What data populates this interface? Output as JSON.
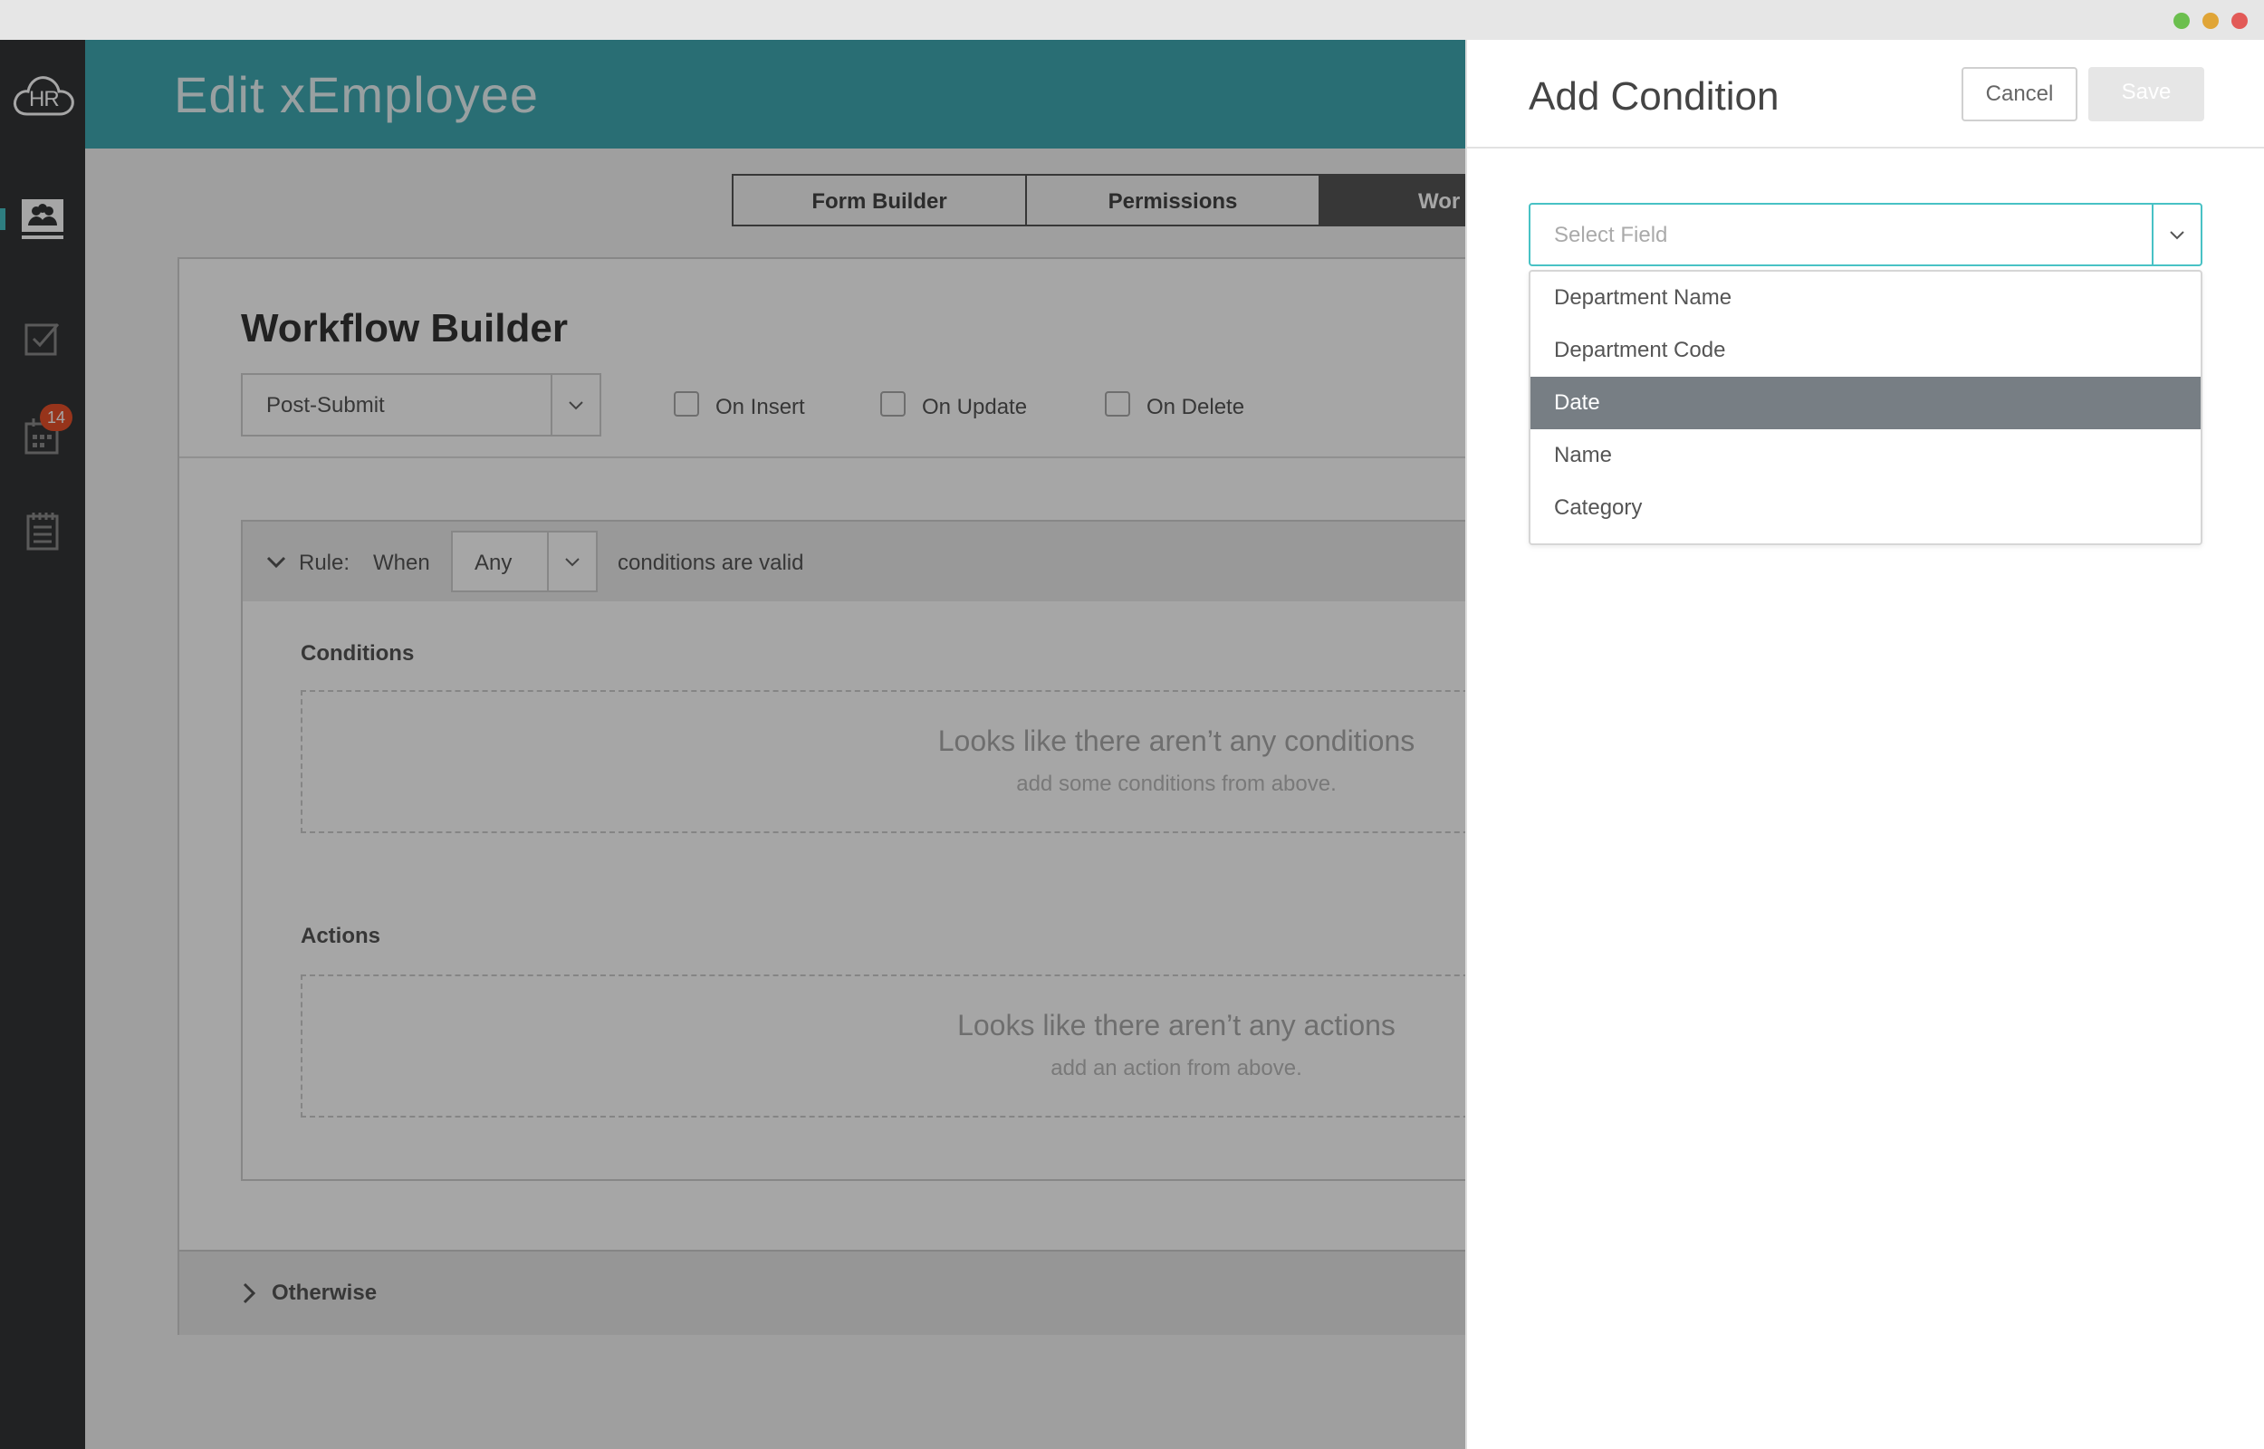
{
  "window": {
    "controls": [
      {
        "name": "zoom",
        "color": "#6bbf4e"
      },
      {
        "name": "minimize",
        "color": "#e0a537"
      },
      {
        "name": "close",
        "color": "#e25a57"
      }
    ]
  },
  "sidebar": {
    "logo": "HR",
    "items": [
      {
        "icon": "people-card-icon",
        "active": true
      },
      {
        "icon": "checkbox-icon"
      },
      {
        "icon": "calendar-icon",
        "badge": "14"
      },
      {
        "icon": "notepad-icon"
      }
    ]
  },
  "header": {
    "title": "Edit xEmployee"
  },
  "tabs": [
    {
      "label": "Form Builder"
    },
    {
      "label": "Permissions"
    },
    {
      "label": "Wor"
    }
  ],
  "workflow": {
    "title": "Workflow Builder",
    "trigger": "Post-Submit",
    "checkboxes": [
      {
        "label": "On Insert",
        "checked": false
      },
      {
        "label": "On Update",
        "checked": false
      },
      {
        "label": "On Delete",
        "checked": false
      }
    ],
    "rule": {
      "label": "Rule:",
      "when": "When",
      "match": "Any",
      "suffix": "conditions are valid",
      "conditions_label": "Conditions",
      "conditions_empty_title": "Looks like there aren’t any conditions",
      "conditions_empty_sub": "add some conditions from above.",
      "actions_label": "Actions",
      "actions_empty_title": "Looks like there aren’t any actions",
      "actions_empty_sub": "add an action from above."
    },
    "otherwise": "Otherwise"
  },
  "panel": {
    "title": "Add Condition",
    "cancel": "Cancel",
    "save": "Save",
    "field_placeholder": "Select Field",
    "options": [
      {
        "label": "Department Name"
      },
      {
        "label": "Department Code"
      },
      {
        "label": "Date",
        "selected": true
      },
      {
        "label": "Name"
      },
      {
        "label": "Category"
      }
    ]
  },
  "colors": {
    "accent": "#3fa9b2",
    "badge": "#e8512a",
    "sidebar": "#343537",
    "selected": "#777e84"
  }
}
